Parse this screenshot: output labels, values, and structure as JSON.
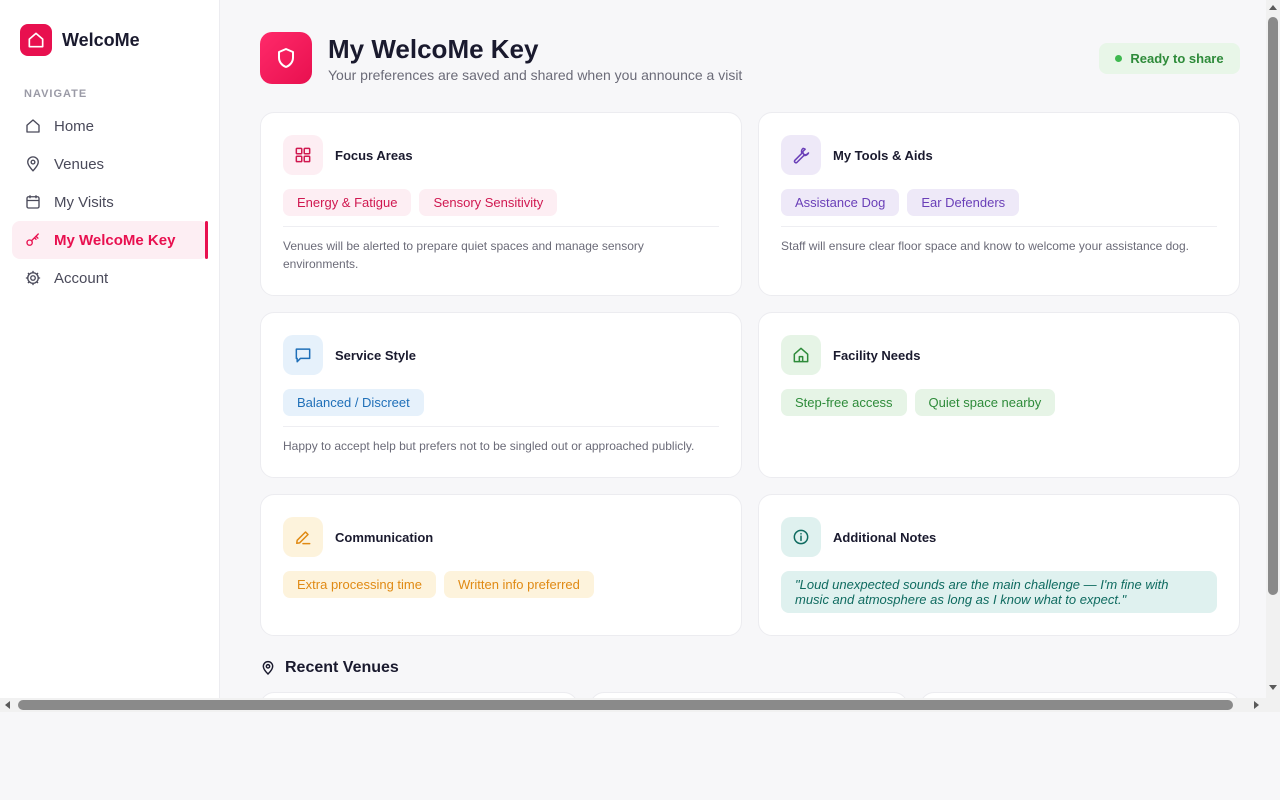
{
  "app": {
    "name": "WelcoMe",
    "brand_color": "#e8104f"
  },
  "sidebar": {
    "heading": "NAVIGATE",
    "items": [
      {
        "label": "Home",
        "icon": "home-icon",
        "active": false
      },
      {
        "label": "Venues",
        "icon": "map-pin-icon",
        "active": false
      },
      {
        "label": "My Visits",
        "icon": "calendar-icon",
        "active": false
      },
      {
        "label": "My WelcoMe Key",
        "icon": "key-icon",
        "active": true
      },
      {
        "label": "Account",
        "icon": "gear-icon",
        "active": false
      }
    ]
  },
  "header": {
    "icon": "shield-icon",
    "title": "My WelcoMe Key",
    "subtitle": "Your preferences are saved and shared when you announce a visit",
    "status": "Ready to share"
  },
  "cards": {
    "focus": {
      "title": "Focus Areas",
      "icon": "grid-icon",
      "chips": [
        "Energy & Fatigue",
        "Sensory Sensitivity"
      ],
      "description": "Venues will be alerted to prepare quiet spaces and manage sensory environments."
    },
    "tools": {
      "title": "My Tools & Aids",
      "icon": "wrench-icon",
      "chips": [
        "Assistance Dog",
        "Ear Defenders"
      ],
      "description": "Staff will ensure clear floor space and know to welcome your assistance dog."
    },
    "service": {
      "title": "Service Style",
      "icon": "chat-bubble-icon",
      "chips": [
        "Balanced / Discreet"
      ],
      "description": "Happy to accept help but prefers not to be singled out or approached publicly."
    },
    "facility": {
      "title": "Facility Needs",
      "icon": "home-icon",
      "chips": [
        "Step-free access",
        "Quiet space nearby"
      ]
    },
    "communication": {
      "title": "Communication",
      "icon": "pencil-icon",
      "chips": [
        "Extra processing time",
        "Written info preferred"
      ]
    },
    "notes": {
      "title": "Additional Notes",
      "icon": "info-icon",
      "text": "\"Loud unexpected sounds are the main challenge — I'm fine with music and atmosphere as long as I know what to expect.\""
    }
  },
  "recent": {
    "title": "Recent Venues",
    "icon": "map-pin-icon"
  }
}
